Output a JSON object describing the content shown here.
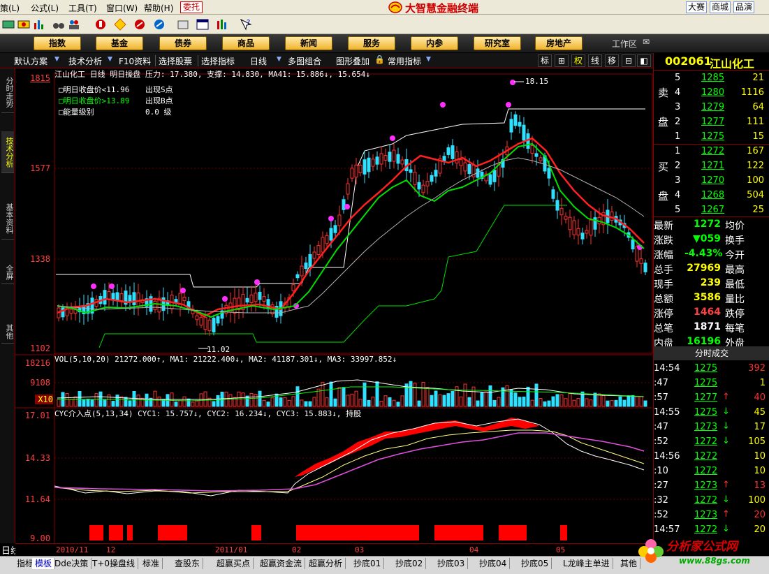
{
  "menu": {
    "items": [
      "策(L)",
      "公式(L)",
      "工具(T)",
      "窗口(W)",
      "帮助(H)"
    ],
    "entrust": "委托",
    "title": "大智慧金融终端",
    "right_links": [
      "大赛",
      "商城",
      "品演"
    ]
  },
  "categories": [
    "指数",
    "基金",
    "债券",
    "商品",
    "新闻",
    "服务",
    "内参",
    "研究室",
    "房地产"
  ],
  "workspace": "工作区",
  "subbar": {
    "items": [
      "默认方案",
      "技术分析",
      "F10资料",
      "选择股票",
      "选择指标",
      "日线",
      "多图组合",
      "图形叠加",
      "常用指标"
    ],
    "tabs": [
      "标",
      "⊞",
      "权",
      "线",
      "移",
      "⊟",
      "◧"
    ]
  },
  "left_tabs": [
    "分时走势",
    "技术分析",
    "基本资料",
    "全屏",
    "其他"
  ],
  "chart": {
    "header": "江山化工 日线 明日操盘 压力: 17.380, 支撑: 14.830, MA41: 15.886↓, 15.654↓",
    "legend": [
      {
        "label": "□明日收盘价<11.96",
        "signal": "出现S点"
      },
      {
        "label": "□明日收盘价>13.89",
        "signal": "出现B点"
      },
      {
        "label": "□能量级别",
        "signal": "0.0 级"
      }
    ],
    "price_axis": [
      "1815",
      "1577",
      "1338",
      "1102"
    ],
    "high_label": "18.15",
    "low_label": "11.02",
    "vol_header": "VOL(5,10,20) 21272.000↑, MA1: 21222.400↓, MA2: 41187.301↓, MA3: 33997.852↓",
    "vol_axis": [
      "18216",
      "9108",
      "X10"
    ],
    "cyc_header": "CYC介入点(5,13,34) CYC1: 15.757↓, CYC2: 16.234↓, CYC3: 15.883↓, 持股",
    "cyc_axis": [
      "17.01",
      "14.33",
      "11.64",
      "9.00"
    ],
    "time_labels": [
      "2010/11",
      "12",
      "2011/01",
      "02",
      "03",
      "04",
      "05"
    ],
    "period": "日线"
  },
  "quote": {
    "code": "002061",
    "name": "江山化工",
    "sell_label": [
      "卖",
      "盘"
    ],
    "buy_label": [
      "买",
      "盘"
    ],
    "sell": [
      {
        "level": "5",
        "price": "1285",
        "vol": "21"
      },
      {
        "level": "4",
        "price": "1280",
        "vol": "1116"
      },
      {
        "level": "3",
        "price": "1279",
        "vol": "64"
      },
      {
        "level": "2",
        "price": "1277",
        "vol": "111"
      },
      {
        "level": "1",
        "price": "1275",
        "vol": "15"
      }
    ],
    "buy": [
      {
        "level": "1",
        "price": "1272",
        "vol": "167"
      },
      {
        "level": "2",
        "price": "1271",
        "vol": "122"
      },
      {
        "level": "3",
        "price": "1270",
        "vol": "100"
      },
      {
        "level": "4",
        "price": "1268",
        "vol": "504"
      },
      {
        "level": "5",
        "price": "1267",
        "vol": "25"
      }
    ],
    "stats": [
      {
        "k": "最新",
        "v": "1272",
        "k2": "均价",
        "color": "#00ff00"
      },
      {
        "k": "涨跌",
        "v": "▼059",
        "k2": "换手",
        "color": "#00ff00"
      },
      {
        "k": "涨幅",
        "v": "-4.43%",
        "k2": "今开",
        "color": "#00ff00"
      },
      {
        "k": "总手",
        "v": "27969",
        "k2": "最高",
        "color": "#ffff00"
      },
      {
        "k": "现手",
        "v": "239",
        "k2": "最低",
        "color": "#ffff00"
      },
      {
        "k": "总额",
        "v": "3586",
        "k2": "量比",
        "color": "#ffff00"
      },
      {
        "k": "涨停",
        "v": "1464",
        "k2": "跌停",
        "color": "#ff4040"
      },
      {
        "k": "总笔",
        "v": "1871",
        "k2": "每笔",
        "color": "#ffffff"
      },
      {
        "k": "内盘",
        "v": "16196",
        "k2": "外盘",
        "color": "#00ff00"
      }
    ],
    "ticks_title": "分时成交",
    "ticks": [
      {
        "t": "14:54",
        "p": "1275",
        "a": "",
        "v": "392"
      },
      {
        "t": ":47",
        "p": "1275",
        "a": "",
        "v": "1"
      },
      {
        "t": ":57",
        "p": "1277",
        "a": "↑",
        "v": "40"
      },
      {
        "t": "14:55",
        "p": "1275",
        "a": "↓",
        "v": "45"
      },
      {
        "t": ":47",
        "p": "1273",
        "a": "↓",
        "v": "17"
      },
      {
        "t": ":52",
        "p": "1272",
        "a": "↓",
        "v": "105"
      },
      {
        "t": "14:56",
        "p": "1272",
        "a": "",
        "v": "10"
      },
      {
        "t": ":10",
        "p": "1272",
        "a": "",
        "v": "10"
      },
      {
        "t": ":27",
        "p": "1273",
        "a": "↑",
        "v": "13"
      },
      {
        "t": ":32",
        "p": "1272",
        "a": "↓",
        "v": "100"
      },
      {
        "t": ":52",
        "p": "1273",
        "a": "↑",
        "v": "20"
      },
      {
        "t": "14:57",
        "p": "1272",
        "a": "↓",
        "v": "20"
      }
    ]
  },
  "bottom_tabs": [
    "指标",
    "模板",
    "Dde决策",
    "T+0操盘线",
    "标准",
    "查股东",
    "超赢买点",
    "超赢资金流",
    "超赢分析",
    "抄底01",
    "抄底02",
    "抄底03",
    "抄底04",
    "抄底05",
    "L龙峰主单进",
    "其他"
  ],
  "watermark": {
    "text": "分析家公式网",
    "url": "www.88gs.com"
  },
  "colors": {
    "up": "#ff3030",
    "down": "#30e0ff",
    "accent": "#ffff00",
    "green": "#00ff00"
  }
}
